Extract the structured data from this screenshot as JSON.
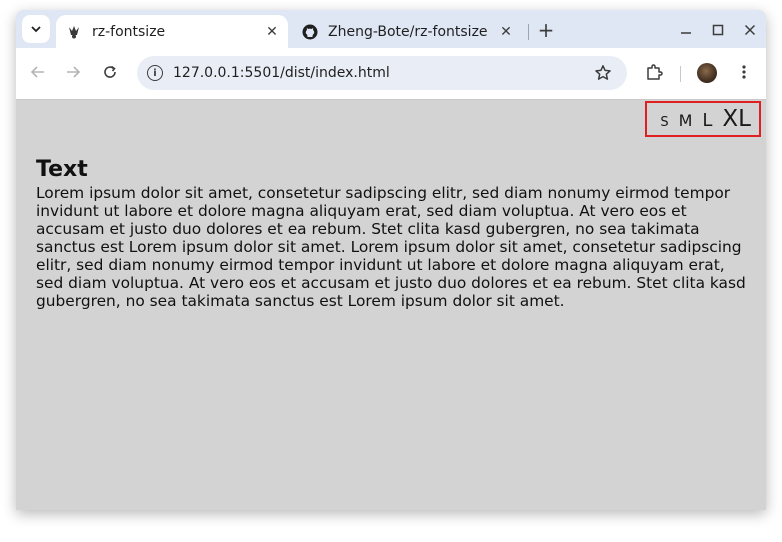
{
  "browser": {
    "tabs": [
      {
        "title": "rz-fontsize",
        "active": true,
        "favicon": "jester-icon"
      },
      {
        "title": "Zheng-Bote/rz-fontsize",
        "active": false,
        "favicon": "github-icon"
      }
    ],
    "address_bar": {
      "url": "127.0.0.1:5501/dist/index.html"
    },
    "icons": {
      "tab_search": "chevron-down-icon",
      "close_tab": "close-icon",
      "new_tab": "plus-icon",
      "minimize": "minimize-icon",
      "maximize": "maximize-icon",
      "close_window": "close-icon",
      "back": "arrow-left-icon",
      "forward": "arrow-right-icon",
      "reload": "reload-icon",
      "site_info": "info-icon",
      "bookmark": "star-icon",
      "extensions": "puzzle-icon",
      "menu": "kebab-menu-icon"
    }
  },
  "page": {
    "font_size_buttons": [
      "S",
      "M",
      "L",
      "XL"
    ],
    "heading": "Text",
    "paragraph": "Lorem ipsum dolor sit amet, consetetur sadipscing elitr, sed diam nonumy eirmod tempor invidunt ut labore et dolore magna aliquyam erat, sed diam voluptua. At vero eos et accusam et justo duo dolores et ea rebum. Stet clita kasd gubergren, no sea takimata sanctus est Lorem ipsum dolor sit amet. Lorem ipsum dolor sit amet, consetetur sadipscing elitr, sed diam nonumy eirmod tempor invidunt ut labore et dolore magna aliquyam erat, sed diam voluptua. At vero eos et accusam et justo duo dolores et ea rebum. Stet clita kasd gubergren, no sea takimata sanctus est Lorem ipsum dolor sit amet."
  },
  "colors": {
    "page_background": "#d3d3d3",
    "highlight_border": "#e02020",
    "tab_strip": "#dfe7f5"
  }
}
